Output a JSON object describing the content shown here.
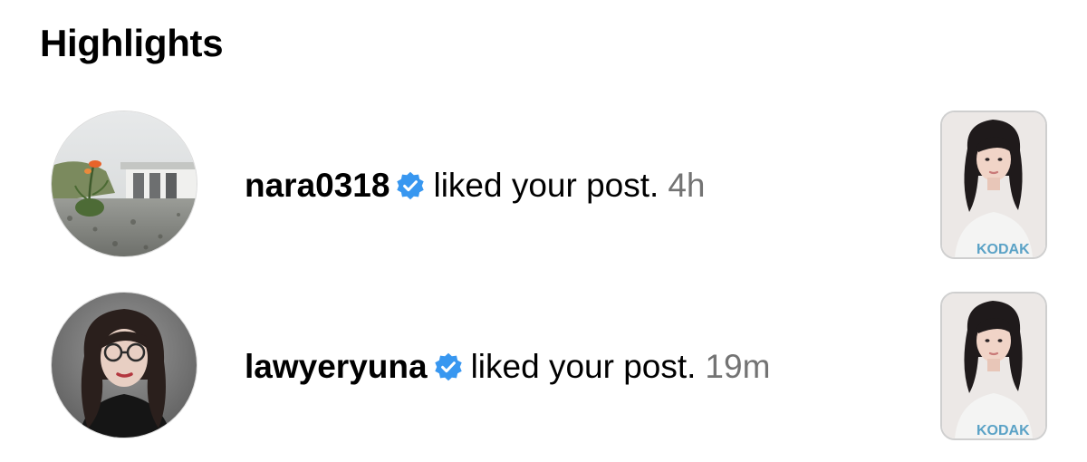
{
  "section": {
    "title": "Highlights"
  },
  "notifications": [
    {
      "username": "nara0318",
      "verified": true,
      "action": "liked your post.",
      "time": "4h",
      "avatar_icon": "landscape-flower-avatar",
      "thumbnail_icon": "portrait-post-thumbnail"
    },
    {
      "username": "lawyeryuna",
      "verified": true,
      "action": "liked your post.",
      "time": "19m",
      "avatar_icon": "portrait-glasses-avatar",
      "thumbnail_icon": "portrait-post-thumbnail"
    }
  ],
  "colors": {
    "verified_badge": "#3897f0",
    "timestamp": "#737373",
    "text": "#000000"
  },
  "thumbnail_text": "KODAK"
}
